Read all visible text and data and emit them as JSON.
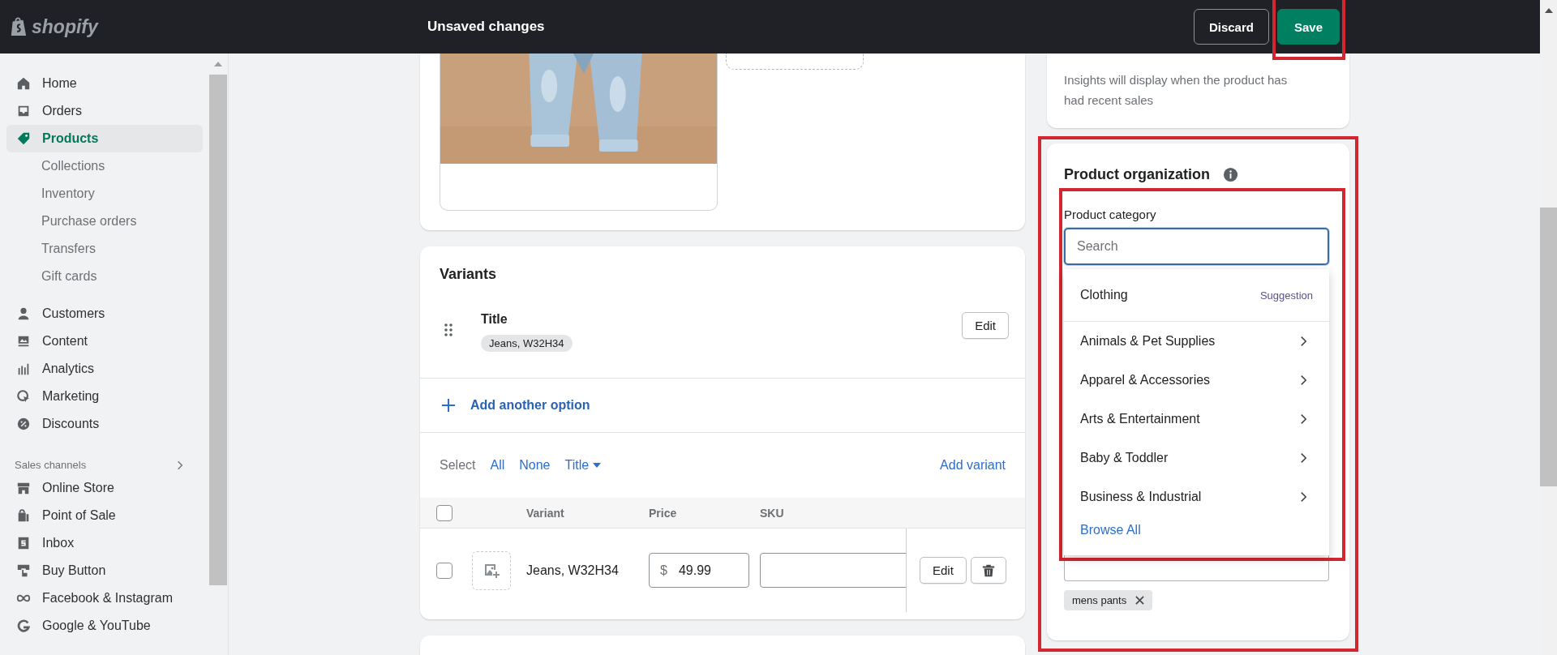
{
  "top_bar": {
    "logo": "shopify",
    "title": "Unsaved changes",
    "buttons": [
      {
        "label": "Discard",
        "kind": "secondary"
      },
      {
        "label": "Save",
        "kind": "primary",
        "highlighted": true
      }
    ]
  },
  "sidebar": {
    "items": [
      {
        "label": "Home",
        "selected": false
      },
      {
        "label": "Orders",
        "selected": false
      },
      {
        "label": "Products",
        "selected": true,
        "children": [
          {
            "label": "Collections",
            "selected": false
          },
          {
            "label": "Inventory",
            "selected": false
          },
          {
            "label": "Purchase orders",
            "selected": false
          },
          {
            "label": "Transfers",
            "selected": false
          },
          {
            "label": "Gift cards",
            "selected": false
          }
        ]
      },
      {
        "label": "Customers",
        "selected": false
      },
      {
        "label": "Content",
        "selected": false
      },
      {
        "label": "Analytics",
        "selected": false
      },
      {
        "label": "Marketing",
        "selected": false
      },
      {
        "label": "Discounts",
        "selected": false
      }
    ],
    "sales_channels": {
      "title": "Sales channels",
      "items": [
        {
          "label": "Online Store",
          "selected": false
        },
        {
          "label": "Point of Sale",
          "selected": false
        },
        {
          "label": "Inbox",
          "selected": false
        },
        {
          "label": "Buy Button",
          "selected": false
        },
        {
          "label": "Facebook & Instagram",
          "selected": false
        },
        {
          "label": "Google & YouTube",
          "selected": false
        }
      ]
    }
  },
  "variants": {
    "title": "Variants",
    "options": [
      {
        "name": "Title",
        "values": [
          "Jeans, W32H34"
        ],
        "edit": "Edit"
      }
    ],
    "add_option": "Add another option",
    "select": {
      "label": "Select",
      "links": [
        "All",
        "None"
      ],
      "filter": "Title"
    },
    "add_variant": "Add variant",
    "all_checked": false,
    "columns": [
      "Variant",
      "Price",
      "SKU"
    ],
    "rows": [
      {
        "checked": false,
        "name": "Jeans, W32H34",
        "currency": "$",
        "price": "49.99",
        "edit": "Edit"
      }
    ]
  },
  "insights": {
    "text": "Insights will display when the product has had recent sales"
  },
  "product_organization": {
    "title": "Product organization",
    "highlighted": true,
    "category": {
      "label": "Product category",
      "placeholder": "Search",
      "highlighted": true,
      "suggestion": {
        "label": "Clothing",
        "badge": "Suggestion"
      },
      "options": [
        {
          "label": "Animals & Pet Supplies"
        },
        {
          "label": "Apparel & Accessories"
        },
        {
          "label": "Arts & Entertainment"
        },
        {
          "label": "Baby & Toddler"
        },
        {
          "label": "Business & Industrial"
        }
      ],
      "browse_all": "Browse All"
    },
    "tags": [
      {
        "label": "mens pants"
      }
    ]
  }
}
